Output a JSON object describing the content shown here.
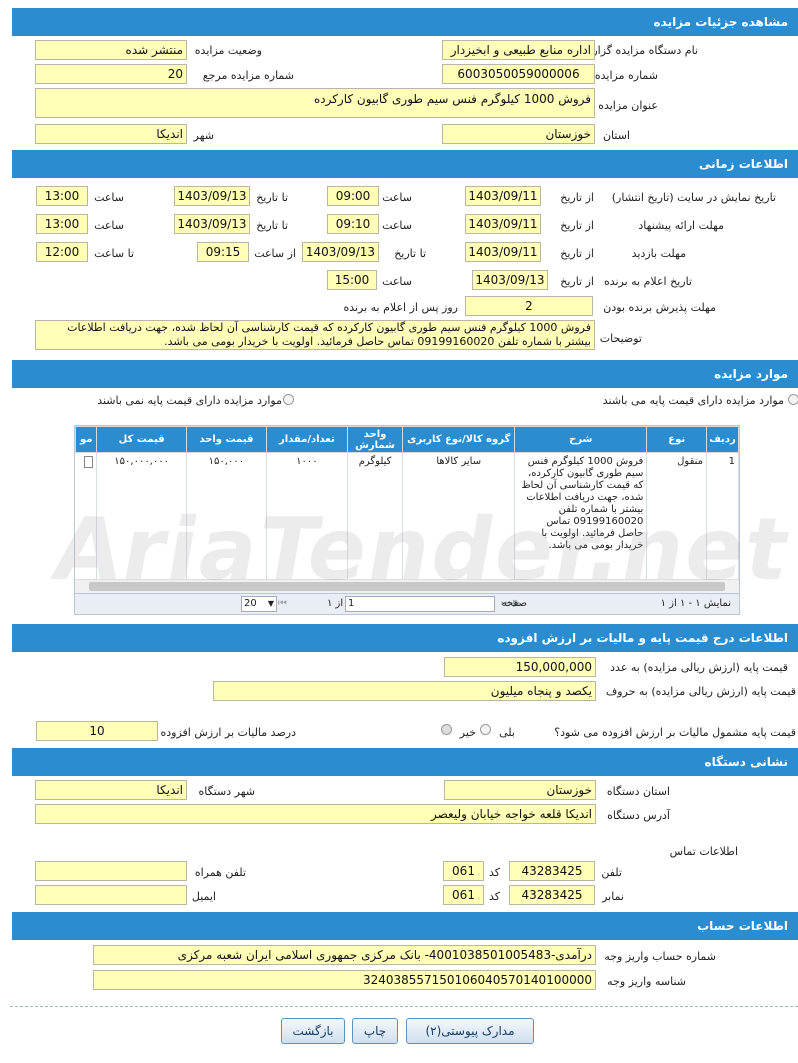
{
  "header": {
    "details": "مشاهده جزئیات مزایده",
    "timing": "اطلاعات زمانی",
    "items": "موارد مزایده",
    "pricing": "اطلاعات درج قیمت پایه و مالیات بر ارزش افزوده",
    "org": "نشانی دستگاه",
    "account": "اطلاعات حساب"
  },
  "details": {
    "org_label": "نام دستگاه مزایده گزار",
    "org_value": "اداره منابع طبیعی و ابخیزدار",
    "status_label": "وضعیت مزایده",
    "status_value": "منتشر شده",
    "number_label": "شماره مزایده",
    "number_value": "6003050059000006",
    "ref_label": "شماره مزایده مرجع",
    "ref_value": "20",
    "title_label": "عنوان مزایده",
    "title_value": "فروش 1000 کیلوگرم فنس سیم طوری گابیون کارکرده",
    "province_label": "استان",
    "province_value": "خوزستان",
    "city_label": "شهر",
    "city_value": "اندیکا"
  },
  "timing": {
    "display_label": "تاریخ نمایش در سایت (تاریخ انتشار)",
    "offer_label": "مهلت ارائه پیشنهاد",
    "visit_label": "مهلت بازدید",
    "winner_label": "تاریخ اعلام به برنده",
    "accept_label": "مهلت پذیرش برنده بودن",
    "from_date": "از تاریخ",
    "to_date": "تا تاریخ",
    "time": "ساعت",
    "from_time": "از ساعت",
    "to_time": "تا ساعت",
    "display_from": "1403/09/11",
    "display_from_time": "09:00",
    "display_to": "1403/09/13",
    "display_to_time": "13:00",
    "offer_from": "1403/09/11",
    "offer_from_time": "09:10",
    "offer_to": "1403/09/13",
    "offer_to_time": "13:00",
    "visit_from": "1403/09/11",
    "visit_to": "1403/09/13",
    "visit_from_time": "09:15",
    "visit_to_time": "12:00",
    "winner_from": "1403/09/13",
    "winner_time": "15:00",
    "accept_days": "2",
    "accept_suffix": "روز پس از اعلام به برنده",
    "desc_label": "توضیحات",
    "desc_value": "فروش 1000 کیلوگرم فنس سیم طوری گابیون کارکرده که قیمت کارشناسی آن لحاظ شده، جهت دریافت اطلاعات بیشتر با شماره تلفن 09199160020 تماس حاصل فرمائید. اولویت با خریدار بومی می باشد."
  },
  "items": {
    "has_base": "موارد مزایده دارای قیمت پایه می باشند",
    "no_base": "موارد مزایده دارای قیمت پایه نمی باشند",
    "columns": [
      "ردیف",
      "نوع",
      "شرح",
      "گروه کالا/نوع کاربری",
      "واحد شمارش",
      "تعداد/مقدار",
      "قیمت واحد",
      "قیمت کل",
      "مو"
    ],
    "rows": [
      {
        "index": "1",
        "type": "منقول",
        "desc": "فروش 1000 کیلوگرم فنس سیم طوری گابیون کارکرده، که قیمت کارشناسی آن لحاظ شده، جهت دریافت اطلاعات بیشتر با شماره تلفن 09199160020 تماس حاصل فرمائید. اولویت با خریدار بومی می باشد.",
        "group": "سایر کالاها",
        "unit": "کیلوگرم",
        "qty": "۱۰۰۰",
        "unit_price": "۱۵۰,۰۰۰",
        "total": "۱۵۰,۰۰۰,۰۰۰"
      }
    ],
    "pager": {
      "summary": "نمایش ۱ - ۱ از ۱",
      "page_label": "صفحه",
      "page_value": "1",
      "of_label": "از ۱",
      "size": "20"
    }
  },
  "pricing": {
    "base_num_label": "قیمت پایه (ارزش ریالی مزایده) به عدد",
    "base_num_value": "150,000,000",
    "base_word_label": "قیمت پایه (ارزش ریالی مزایده) به حروف",
    "base_word_value": "یکصد و پنجاه میلیون",
    "vat_q": "قیمت پایه مشمول مالیات بر ارزش افزوده می شود؟",
    "yes": "بلی",
    "no": "خیر",
    "vat_pct_label": "درصد مالیات بر ارزش افزوده",
    "vat_pct_value": "10"
  },
  "org": {
    "province_label": "استان دستگاه",
    "province_value": "خوزستان",
    "city_label": "شهر دستگاه",
    "city_value": "اندیکا",
    "address_label": "آدرس دستگاه",
    "address_value": "اندیکا قلعه خواجه خیابان ولیعصر",
    "contact_label": "اطلاعات تماس",
    "phone_label": "تلفن",
    "phone_value": "43283425",
    "code_label": "کد",
    "phone_code": "061",
    "fax_label": "نمابر",
    "fax_value": "43283425",
    "fax_code": "061",
    "mobile_label": "تلفن همراه",
    "email_label": "ایمیل"
  },
  "account": {
    "acc_label": "شماره حساب واریز وجه",
    "acc_value": "درآمدی-4001038501005483- بانک مرکزی جمهوری اسلامی ایران شعبه مرکزی",
    "id_label": "شناسه واریز وجه",
    "id_value": "324038557150106040570140100000"
  },
  "buttons": {
    "attachments": "مدارک پیوستی(۲)",
    "print": "چاپ",
    "back": "بازگشت"
  },
  "watermark": "AriaTender.net"
}
